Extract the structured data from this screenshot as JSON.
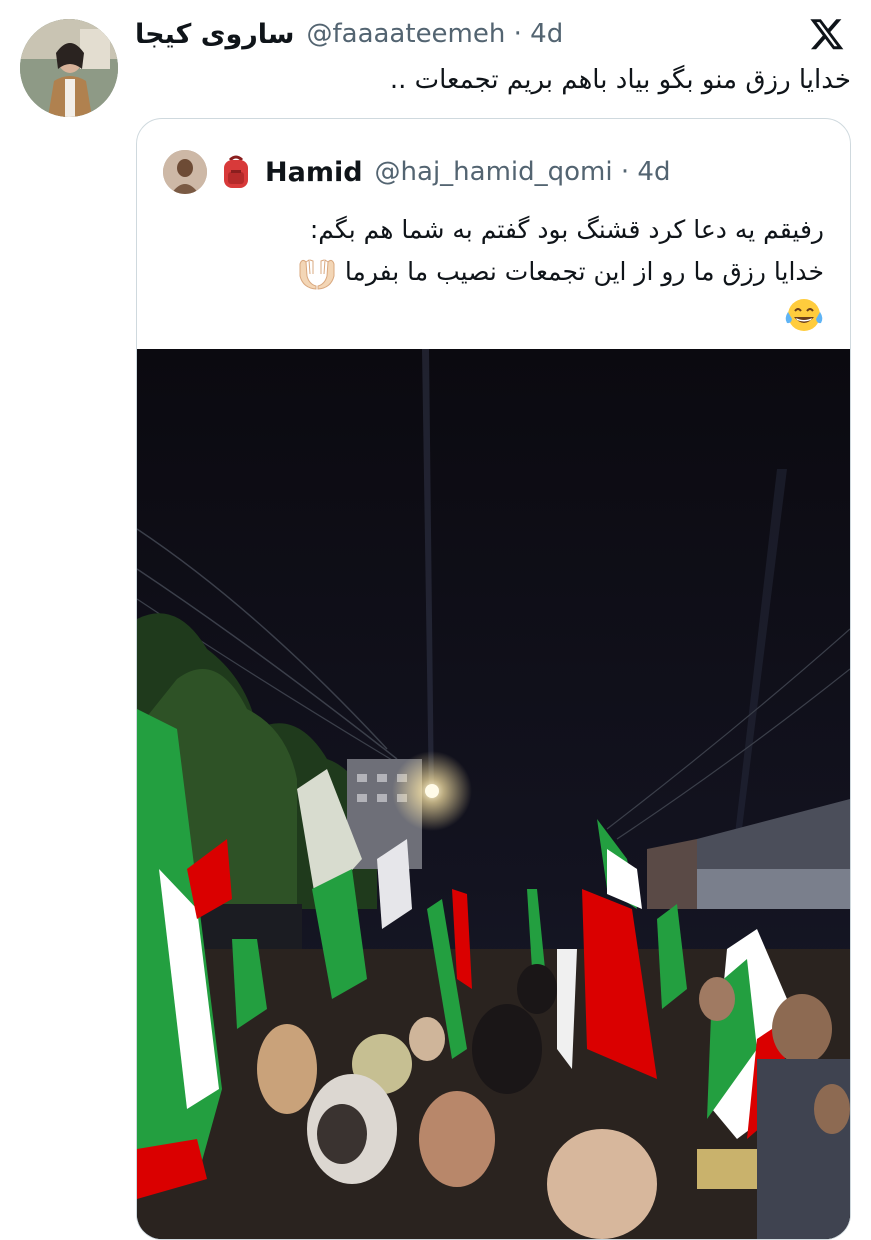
{
  "tweet": {
    "display_name": "ساروی کیجا",
    "handle": "@faaaateemeh",
    "time": "· 4d",
    "text": "خدایا رزق منو بگو بیاد باهم بریم تجمعات ..",
    "icons": {
      "platform": "x-logo-icon",
      "avatar": "author-avatar"
    }
  },
  "quoted_tweet": {
    "display_name": "Hamid",
    "handle": "@haj_hamid_qomi",
    "time": "· 4d",
    "name_emoji": "backpack-icon",
    "lines": [
      "رفیقم یه دعا کرد قشنگ بود گفتم به شما هم بگم:",
      "خدایا رزق ما رو از این تجمعات نصیب ما بفرما"
    ],
    "line_emojis": [
      "palms-up-together-icon",
      "tears-of-joy-icon"
    ],
    "media": "night rally photo with Iranian flags"
  },
  "colors": {
    "text": "#0f1419",
    "secondary": "#536471",
    "border": "#cfd9de",
    "flag_green": "#239f40",
    "flag_red": "#da0000"
  }
}
